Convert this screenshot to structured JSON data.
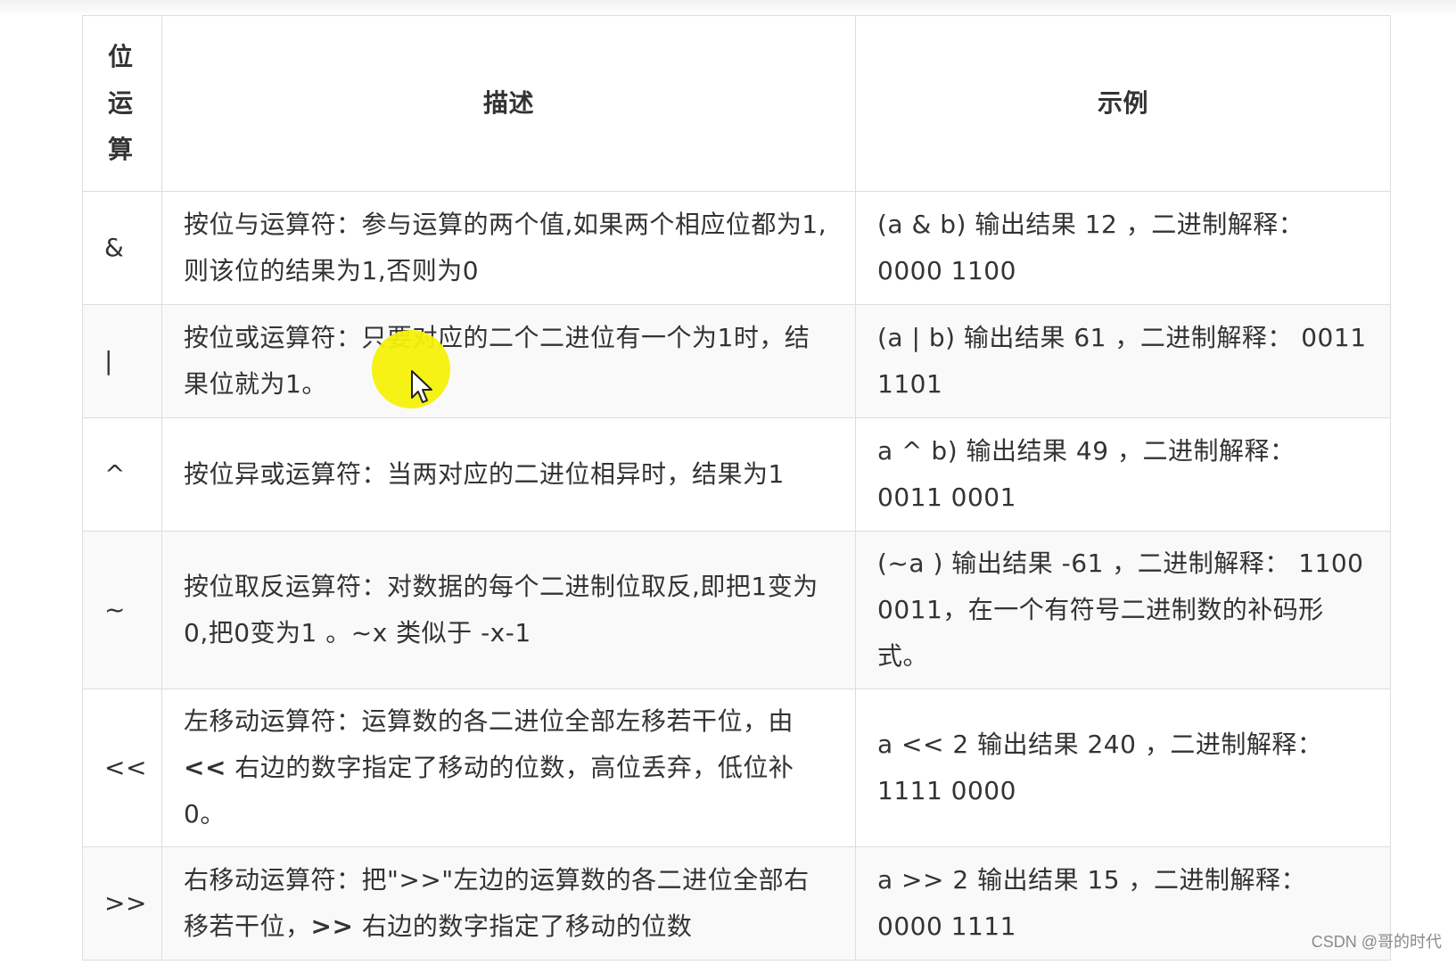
{
  "table": {
    "headers": {
      "operator": "位运算",
      "description": "描述",
      "example": "示例"
    },
    "rows": [
      {
        "operator": "&",
        "description": "按位与运算符：参与运算的两个值,如果两个相应位都为1,则该位的结果为1,否则为0",
        "example": "(a & b) 输出结果 12 ，二进制解释： 0000 1100"
      },
      {
        "operator": "|",
        "description": "按位或运算符：只要对应的二个二进位有一个为1时，结果位就为1。",
        "example": "(a | b) 输出结果 61 ，二进制解释： 0011 1101"
      },
      {
        "operator": "^",
        "description": "按位异或运算符：当两对应的二进位相异时，结果为1",
        "example": "a ^ b) 输出结果 49 ，二进制解释： 0011 0001"
      },
      {
        "operator": "~",
        "description": "按位取反运算符：对数据的每个二进制位取反,即把1变为0,把0变为1 。~x 类似于 -x-1",
        "example": "(~a ) 输出结果 -61 ，二进制解释： 1100 0011，在一个有符号二进制数的补码形式。"
      },
      {
        "operator": "<<",
        "description_parts": [
          "左移动运算符：运算数的各二进位全部左移若干位，由 ",
          "<<",
          " 右边的数字指定了移动的位数，高位丢弃，低位补0。"
        ],
        "example": "a << 2 输出结果 240 ，二进制解释： 1111 0000"
      },
      {
        "operator": ">>",
        "description_parts": [
          "右移动运算符：把\">>\"左边的运算数的各二进位全部右移若干位，",
          ">>",
          " 右边的数字指定了移动的位数"
        ],
        "example": "a >> 2 输出结果 15 ，二进制解释： 0000 1111"
      }
    ]
  },
  "watermark": "CSDN @哥的时代",
  "cursor": {
    "icon": "mouse-pointer-icon",
    "highlight_color": "#f5f10a"
  }
}
